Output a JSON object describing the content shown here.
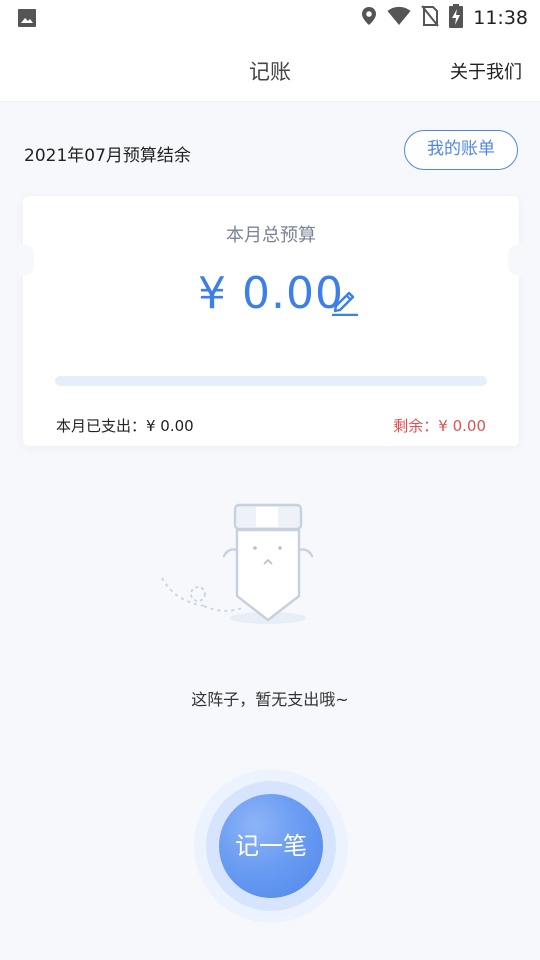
{
  "status_bar": {
    "time": "11:38",
    "icons": [
      "image-icon",
      "location-icon",
      "wifi-icon",
      "no-sim-icon",
      "battery-charging-icon"
    ]
  },
  "header": {
    "title": "记账",
    "about_label": "关于我们"
  },
  "month": {
    "label": "2021年07月预算结余",
    "bill_button_label": "我的账单"
  },
  "budget_card": {
    "title": "本月总预算",
    "amount": "¥ 0.00",
    "progress": 0,
    "spent_label": "本月已支出：¥ 0.00",
    "remaining_label": "剩余：¥ 0.00",
    "edit_icon": "edit-pencil-icon"
  },
  "empty_state": {
    "illustration": "empty-box-illustration",
    "text": "这阵子，暂无支出哦~"
  },
  "fab": {
    "label": "记一笔"
  },
  "colors": {
    "accent": "#4f86e8",
    "amount": "#3d7fe8",
    "remaining": "#e05050",
    "background": "#f6f8fc"
  }
}
